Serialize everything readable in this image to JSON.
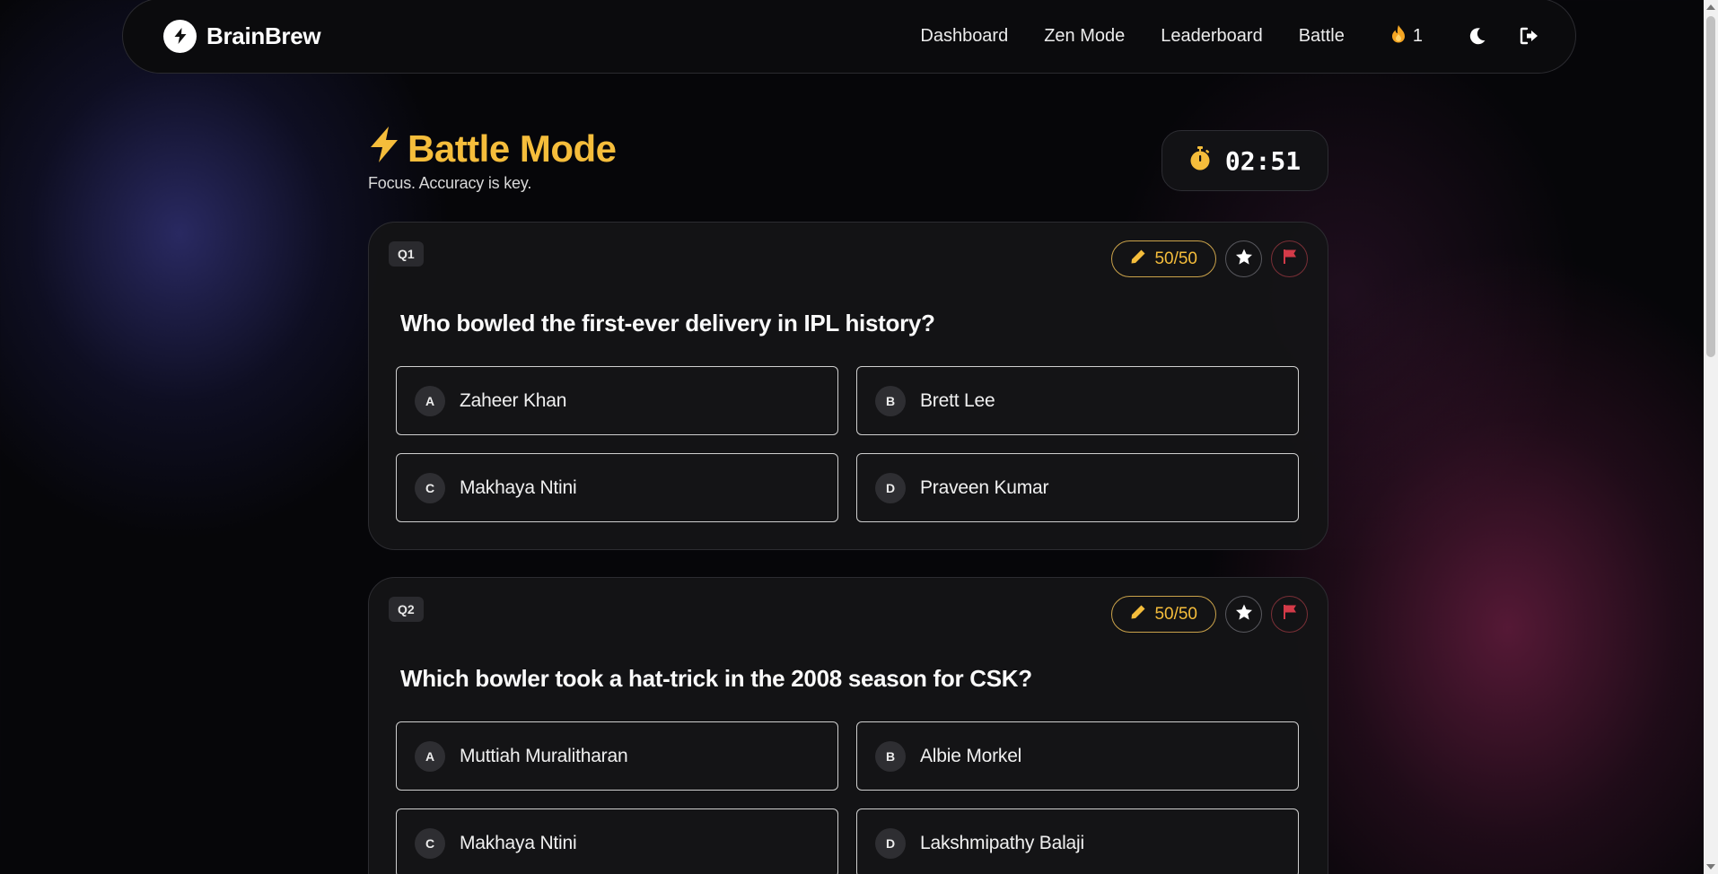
{
  "app": {
    "name": "BrainBrew",
    "logo_icon": "bolt-icon"
  },
  "nav": {
    "links": [
      "Dashboard",
      "Zen Mode",
      "Leaderboard",
      "Battle"
    ],
    "streak": {
      "icon": "fire-icon",
      "count": "1"
    },
    "icons": [
      "moon-icon",
      "logout-icon"
    ]
  },
  "header": {
    "title": "Battle Mode",
    "title_icon": "bolt-icon",
    "subtitle": "Focus. Accuracy is key."
  },
  "timer": {
    "icon": "stopwatch-icon",
    "value": "02:51"
  },
  "questions": [
    {
      "badge": "Q1",
      "lifeline": "50/50",
      "text": "Who bowled the first-ever delivery in IPL history?",
      "options": [
        {
          "letter": "A",
          "text": "Zaheer Khan"
        },
        {
          "letter": "B",
          "text": "Brett Lee"
        },
        {
          "letter": "C",
          "text": "Makhaya Ntini"
        },
        {
          "letter": "D",
          "text": "Praveen Kumar"
        }
      ]
    },
    {
      "badge": "Q2",
      "lifeline": "50/50",
      "text": "Which bowler took a hat-trick in the 2008 season for CSK?",
      "options": [
        {
          "letter": "A",
          "text": "Muttiah Muralitharan"
        },
        {
          "letter": "B",
          "text": "Albie Morkel"
        },
        {
          "letter": "C",
          "text": "Makhaya Ntini"
        },
        {
          "letter": "D",
          "text": "Lakshmipathy Balaji"
        }
      ]
    }
  ],
  "colors": {
    "accent": "#f5bd3b",
    "flag": "#d33a48",
    "background": "#060609"
  }
}
